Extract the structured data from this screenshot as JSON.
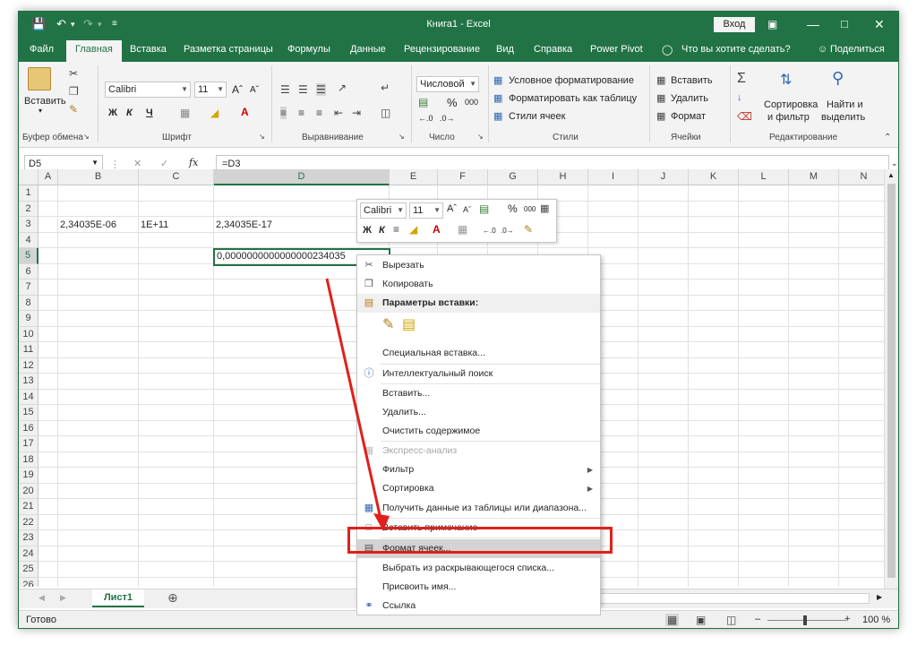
{
  "window": {
    "title": "Книга1 - Excel",
    "signin_label": "Вход"
  },
  "tabs": [
    "Файл",
    "Главная",
    "Вставка",
    "Разметка страницы",
    "Формулы",
    "Данные",
    "Рецензирование",
    "Вид",
    "Справка",
    "Power Pivot"
  ],
  "tell_me": "Что вы хотите сделать?",
  "share_label": "Поделиться",
  "ribbon": {
    "clipboard": {
      "paste_label": "Вставить",
      "group_label": "Буфер обмена"
    },
    "font": {
      "font_name": "Calibri",
      "font_size": "11",
      "bold": "Ж",
      "italic": "К",
      "underline": "Ч",
      "group_label": "Шрифт"
    },
    "alignment": {
      "group_label": "Выравнивание"
    },
    "number": {
      "format": "Числовой",
      "percent": "%",
      "thousands": "000",
      "group_label": "Число"
    },
    "styles": {
      "conditional": "Условное форматирование",
      "as_table": "Форматировать как таблицу",
      "cell_styles": "Стили ячеек",
      "group_label": "Стили"
    },
    "cells": {
      "insert": "Вставить",
      "delete": "Удалить",
      "format": "Формат",
      "group_label": "Ячейки"
    },
    "editing": {
      "sort_line1": "Сортировка",
      "sort_line2": "и фильтр",
      "find_line1": "Найти и",
      "find_line2": "выделить",
      "group_label": "Редактирование"
    }
  },
  "formula_bar": {
    "name_box": "D5",
    "fx_symbol": "fx",
    "formula": "=D3"
  },
  "columns": [
    "A",
    "B",
    "C",
    "D",
    "E",
    "F",
    "G",
    "H",
    "I",
    "J",
    "K",
    "L",
    "M",
    "N"
  ],
  "rows": [
    "1",
    "2",
    "3",
    "4",
    "5",
    "6",
    "7",
    "8",
    "9",
    "10",
    "11",
    "12",
    "13",
    "14",
    "15",
    "16",
    "17",
    "18",
    "19",
    "20",
    "21",
    "22",
    "23",
    "24",
    "25",
    "26"
  ],
  "cells": {
    "B3": "2,34035E-06",
    "C3": "1E+11",
    "D3": "2,34035E-17",
    "D5": "0,0000000000000000234035"
  },
  "mini_toolbar": {
    "font_name": "Calibri",
    "font_size": "11",
    "bold": "Ж",
    "italic": "К",
    "percent": "%",
    "thousands": "000"
  },
  "context_menu": {
    "cut": "Вырезать",
    "copy": "Копировать",
    "paste_options": "Параметры вставки:",
    "paste_special": "Специальная вставка...",
    "smart_lookup": "Интеллектуальный поиск",
    "insert": "Вставить...",
    "delete": "Удалить...",
    "clear": "Очистить содержимое",
    "quick_analysis": "Экспресс-анализ",
    "filter": "Фильтр",
    "sort": "Сортировка",
    "get_data": "Получить данные из таблицы или диапазона...",
    "insert_comment": "Вставить примечание",
    "format_cells": "Формат ячеек...",
    "pick_from_list": "Выбрать из раскрывающегося списка...",
    "define_name": "Присвоить имя...",
    "link": "Ссылка"
  },
  "sheet_tab": "Лист1",
  "status": {
    "ready": "Готово",
    "zoom": "100 %"
  },
  "colors": {
    "excel_green": "#217346",
    "highlight_red": "#e0201b"
  }
}
